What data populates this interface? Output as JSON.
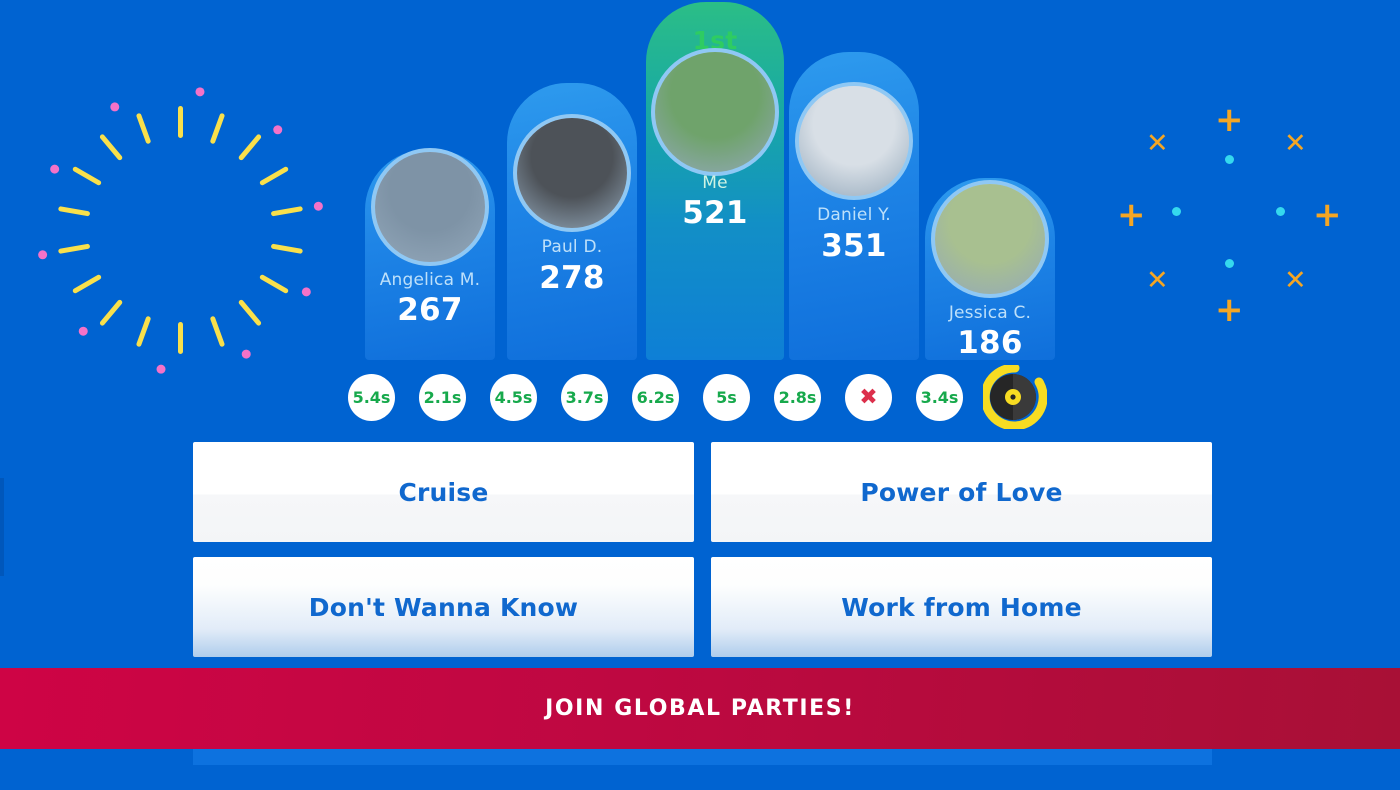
{
  "theme": {
    "background": "#0063d1",
    "bar_blue_top": "#2E9BEE",
    "bar_blue_bottom": "#0F6FDB",
    "winner_green": "#2BBE86",
    "rank_green": "#2ECC62",
    "badge_time_color": "#17A94C",
    "badge_miss_color": "#DC2F4B",
    "answer_text_color": "#1068CE",
    "banner_from": "#CE0445",
    "banner_to": "#A81036",
    "burst_dash": "#F9E04B",
    "burst_dot": "#F472C8",
    "cluster_glyph": "#F5A623",
    "cluster_dot": "#35D9EE",
    "vinyl_ring": "#F7DC22",
    "vinyl_body": "#262626"
  },
  "leaderboard": {
    "players": [
      {
        "name": "Angelica M.",
        "score": "267",
        "rank": "",
        "avatar_icon": "avatar-photo-angelica",
        "avatar_tone": "#7E93A6",
        "winner": false
      },
      {
        "name": "Paul D.",
        "score": "278",
        "rank": "",
        "avatar_icon": "avatar-photo-paul",
        "avatar_tone": "#4D5258",
        "winner": false
      },
      {
        "name": "Me",
        "score": "521",
        "rank": "1st",
        "avatar_icon": "avatar-photo-me",
        "avatar_tone": "#6FA36B",
        "winner": true
      },
      {
        "name": "Daniel Y.",
        "score": "351",
        "rank": "",
        "avatar_icon": "avatar-photo-daniel",
        "avatar_tone": "#D8DFE6",
        "winner": false
      },
      {
        "name": "Jessica C.",
        "score": "186",
        "rank": "",
        "avatar_icon": "avatar-photo-jessica",
        "avatar_tone": "#A8C090",
        "winner": false
      }
    ]
  },
  "timeline": {
    "badges": [
      {
        "label": "5.4s",
        "kind": "time"
      },
      {
        "label": "2.1s",
        "kind": "time"
      },
      {
        "label": "4.5s",
        "kind": "time"
      },
      {
        "label": "3.7s",
        "kind": "time"
      },
      {
        "label": "6.2s",
        "kind": "time"
      },
      {
        "label": "5s",
        "kind": "time"
      },
      {
        "label": "2.8s",
        "kind": "time"
      },
      {
        "label": "✖",
        "kind": "miss"
      },
      {
        "label": "3.4s",
        "kind": "time"
      }
    ],
    "current_icon": "vinyl-record-icon"
  },
  "answers": {
    "options": [
      {
        "label": "Cruise",
        "style": "plain"
      },
      {
        "label": "Power of Love",
        "style": "plain"
      },
      {
        "label": "Don't Wanna Know",
        "style": "tinted"
      },
      {
        "label": "Work from Home",
        "style": "tinted"
      }
    ]
  },
  "banner": {
    "cta_label": "JOIN GLOBAL PARTIES!"
  }
}
